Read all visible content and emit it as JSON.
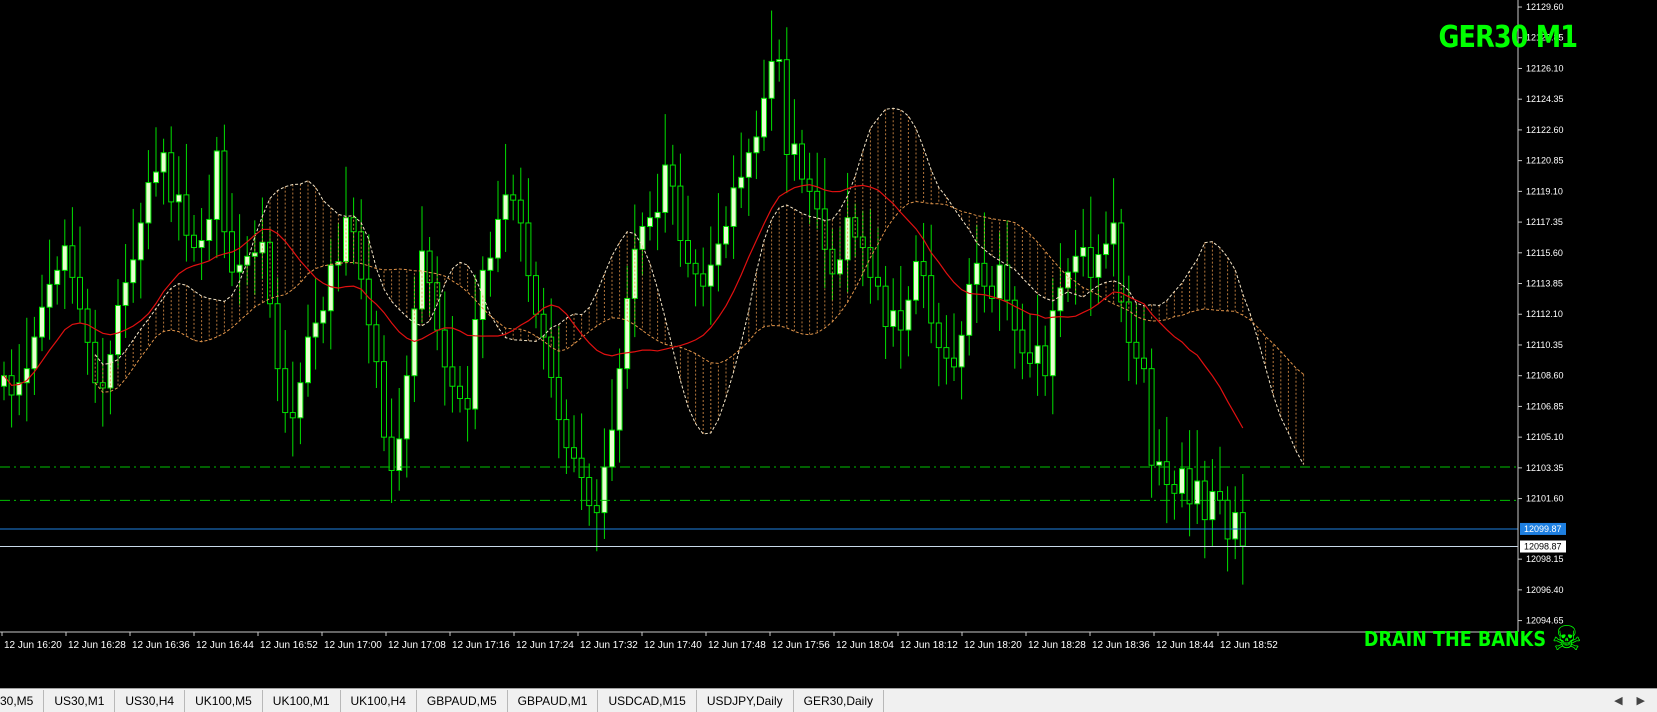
{
  "chart": {
    "symbol_title": "GER30 M1",
    "watermark": "DRAIN THE BANKS",
    "skull_glyph": "☠",
    "bid_price_label": "12099.87",
    "ask_price_label": "12098.87",
    "colors": {
      "background": "#000000",
      "bull_candle": "#e8ffd0",
      "bear_candle": "#000000",
      "wick": "#00e000",
      "moving_average": "#e01010",
      "cloud_upper": "#f5e6c8",
      "cloud_lower": "#e0944a",
      "level_lines": "#00c000",
      "bid_line": "#1e7fe0",
      "ask_line": "#c8d8e8",
      "title_text": "#00ff00"
    }
  },
  "chart_data": {
    "type": "candlestick",
    "symbol": "GER30",
    "timeframe": "M1",
    "ylim": [
      12094.0,
      12130.0
    ],
    "price_ticks": [
      "12129.60",
      "12127.85",
      "12126.10",
      "12124.35",
      "12122.60",
      "12120.85",
      "12119.10",
      "12117.35",
      "12115.60",
      "12113.85",
      "12112.10",
      "12110.35",
      "12108.60",
      "12106.85",
      "12105.10",
      "12103.35",
      "12101.60",
      "12098.15",
      "12096.40",
      "12094.65"
    ],
    "time_ticks": [
      "12 Jun 16:20",
      "12 Jun 16:28",
      "12 Jun 16:36",
      "12 Jun 16:44",
      "12 Jun 16:52",
      "12 Jun 17:00",
      "12 Jun 17:08",
      "12 Jun 17:16",
      "12 Jun 17:24",
      "12 Jun 17:32",
      "12 Jun 17:40",
      "12 Jun 17:48",
      "12 Jun 17:56",
      "12 Jun 18:04",
      "12 Jun 18:12",
      "12 Jun 18:20",
      "12 Jun 18:28",
      "12 Jun 18:36",
      "12 Jun 18:44",
      "12 Jun 18:52"
    ],
    "horizontal_levels": [
      12103.4,
      12101.5
    ],
    "bid": 12099.87,
    "ask": 12098.87,
    "close_series": [
      12108.6,
      12107.5,
      12108.2,
      12109.0,
      12110.8,
      12112.5,
      12113.8,
      12114.6,
      12116.0,
      12114.2,
      12112.4,
      12110.5,
      12108.2,
      12107.9,
      12109.8,
      12112.6,
      12113.9,
      12115.2,
      12117.3,
      12119.6,
      12120.2,
      12121.3,
      12118.5,
      12118.9,
      12116.6,
      12115.9,
      12116.3,
      12117.5,
      12121.4,
      12116.8,
      12114.5,
      12114.9,
      12115.4,
      12115.6,
      12116.2,
      12112.7,
      12109.0,
      12106.5,
      12106.2,
      12108.2,
      12110.8,
      12111.6,
      12112.3,
      12114.9,
      12115.1,
      12117.6,
      12116.8,
      12114.1,
      12111.5,
      12109.4,
      12105.1,
      12103.2,
      12105.0,
      12108.6,
      12112.4,
      12115.7,
      12113.9,
      12111.2,
      12109.1,
      12108.0,
      12107.3,
      12106.7,
      12111.8,
      12114.6,
      12115.3,
      12117.5,
      12118.9,
      12118.6,
      12117.3,
      12114.3,
      12112.1,
      12110.8,
      12108.5,
      12106.1,
      12104.5,
      12103.9,
      12102.8,
      12101.2,
      12100.8,
      12103.4,
      12105.5,
      12109.0,
      12113.0,
      12115.8,
      12117.1,
      12117.6,
      12117.9,
      12120.6,
      12119.4,
      12116.3,
      12115.0,
      12114.4,
      12113.7,
      12114.9,
      12116.1,
      12117.1,
      12119.3,
      12119.9,
      12121.3,
      12122.2,
      12124.4,
      12126.5,
      12126.6,
      12121.2,
      12121.8,
      12119.8,
      12119.1,
      12118.1,
      12115.8,
      12114.4,
      12115.2,
      12117.6,
      12116.5,
      12115.9,
      12114.2,
      12113.7,
      12111.4,
      12112.3,
      12111.2,
      12112.9,
      12115.1,
      12114.3,
      12111.6,
      12110.2,
      12109.6,
      12109.1,
      12110.9,
      12113.8,
      12115.0,
      12113.7,
      12113.0,
      12114.9,
      12112.9,
      12111.2,
      12109.9,
      12109.3,
      12110.3,
      12108.6,
      12112.3,
      12113.6,
      12114.5,
      12115.4,
      12115.9,
      12114.2,
      12115.5,
      12116.1,
      12117.3,
      12112.8,
      12110.5,
      12109.6,
      12109.0,
      12103.5,
      12103.7,
      12102.4,
      12101.9,
      12103.3,
      12101.3,
      12102.6,
      12100.4,
      12102.0,
      12101.5,
      12099.3,
      12100.8,
      12098.9
    ]
  },
  "tabbar": {
    "tabs": [
      "30,M5",
      "US30,M1",
      "US30,H4",
      "UK100,M5",
      "UK100,M1",
      "UK100,H4",
      "GBPAUD,M5",
      "GBPAUD,M1",
      "USDCAD,M15",
      "USDJPY,Daily",
      "GER30,Daily"
    ],
    "scroll_left": "◀",
    "scroll_right": "▶"
  }
}
